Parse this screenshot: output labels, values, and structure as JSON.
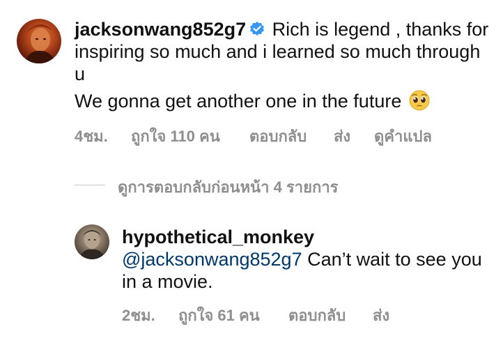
{
  "comment": {
    "username": "jacksonwang852g7",
    "text": " Rich is legend , thanks for inspiring so much and i learned so much through u",
    "text_line2": "We gonna get another one in the future",
    "emoji": "pleading-face-emoji",
    "time": "4ชม.",
    "likes": "ถูกใจ 110 คน",
    "reply_label": "ตอบกลับ",
    "send_label": "ส่ง",
    "translate_label": "ดูคำแปล",
    "view_replies": "ดูการตอบกลับก่อนหน้า 4 รายการ"
  },
  "reply": {
    "username": "hypothetical_monkey",
    "mention": "@jacksonwang852g7",
    "text": " Can’t wait to see you in a movie.",
    "time": "2ชม.",
    "likes": "ถูกใจ 61 คน",
    "reply_label": "ตอบกลับ",
    "send_label": "ส่ง"
  },
  "colors": {
    "verified_badge": "#3897f0",
    "meta_text": "#8e8e8e",
    "mention": "#00376b"
  }
}
